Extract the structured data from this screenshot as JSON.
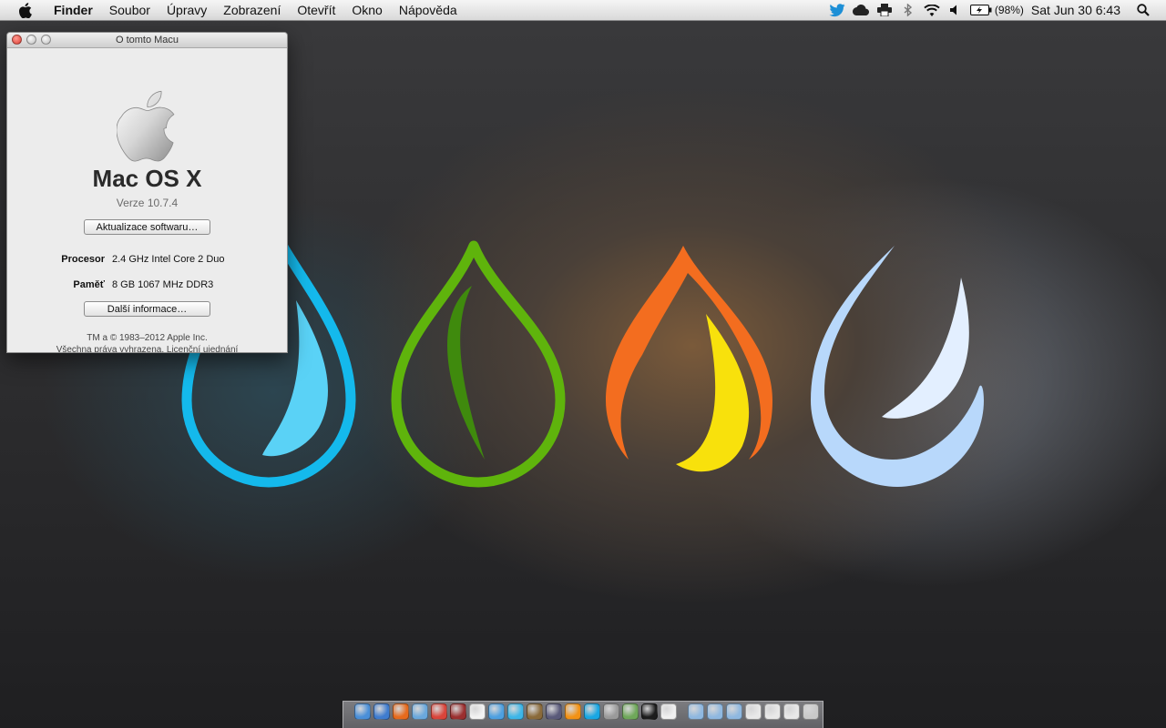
{
  "menubar": {
    "app_name": "Finder",
    "items": [
      "Soubor",
      "Úpravy",
      "Zobrazení",
      "Otevřít",
      "Okno",
      "Nápověda"
    ],
    "status": {
      "battery_percent": "(98%)",
      "clock": "Sat Jun 30  6:43"
    }
  },
  "about": {
    "window_title": "O tomto Macu",
    "os_name": "Mac OS X",
    "version": "Verze 10.7.4",
    "update_button": "Aktualizace softwaru…",
    "processor_label": "Procesor",
    "processor_value": "2.4 GHz Intel Core 2 Duo",
    "memory_label": "Paměť",
    "memory_value": "8 GB 1067 MHz  DDR3",
    "more_info_button": "Další informace…",
    "legal_line1": "TM a © 1983–2012 Apple Inc.",
    "legal_line2": "Všechna práva vyhrazena.  Licenční ujednání"
  },
  "wallpaper": {
    "drop_colors": [
      "#14b9ec",
      "#5fb40c",
      "#f36d1f",
      "#b8d8fb"
    ],
    "accent_colors": [
      "#5ad2f6",
      "#3f8a0d",
      "#f8e10c",
      "#e3efff"
    ]
  },
  "dock": {
    "icons": [
      {
        "name": "finder-icon",
        "color": "#4a8fd8"
      },
      {
        "name": "app-store-icon",
        "color": "#3f7ccf"
      },
      {
        "name": "firefox-icon",
        "color": "#e66a1c"
      },
      {
        "name": "safari-icon",
        "color": "#6aa8dc"
      },
      {
        "name": "chrome-icon",
        "color": "#d9443a"
      },
      {
        "name": "photo-booth-icon",
        "color": "#9b2f2f"
      },
      {
        "name": "calendar-icon",
        "color": "#f2f2f2"
      },
      {
        "name": "itunes-icon",
        "color": "#4ea0e0"
      },
      {
        "name": "twitter-icon",
        "color": "#3db6e8"
      },
      {
        "name": "preview-icon",
        "color": "#8a6a3a"
      },
      {
        "name": "pen-tool-icon",
        "color": "#5a5a7a"
      },
      {
        "name": "vlc-icon",
        "color": "#f39214"
      },
      {
        "name": "skype-icon",
        "color": "#19a7e3"
      },
      {
        "name": "system-preferences-icon",
        "color": "#9a9a9a"
      },
      {
        "name": "activity-monitor-icon",
        "color": "#6fa85a"
      },
      {
        "name": "terminal-icon",
        "color": "#1c1c1c"
      },
      {
        "name": "text-edit-icon",
        "color": "#f0f0f0"
      }
    ],
    "folders": [
      {
        "name": "applications-folder-icon",
        "color": "#8fb8e0"
      },
      {
        "name": "documents-folder-icon",
        "color": "#8fb8e0"
      },
      {
        "name": "downloads-folder-icon",
        "color": "#8fb8e0"
      },
      {
        "name": "stack-icon-1",
        "color": "#e8e8e8"
      },
      {
        "name": "stack-icon-2",
        "color": "#e8e8e8"
      },
      {
        "name": "stack-icon-3",
        "color": "#e8e8e8"
      },
      {
        "name": "trash-icon",
        "color": "#c9c9c9"
      }
    ]
  }
}
